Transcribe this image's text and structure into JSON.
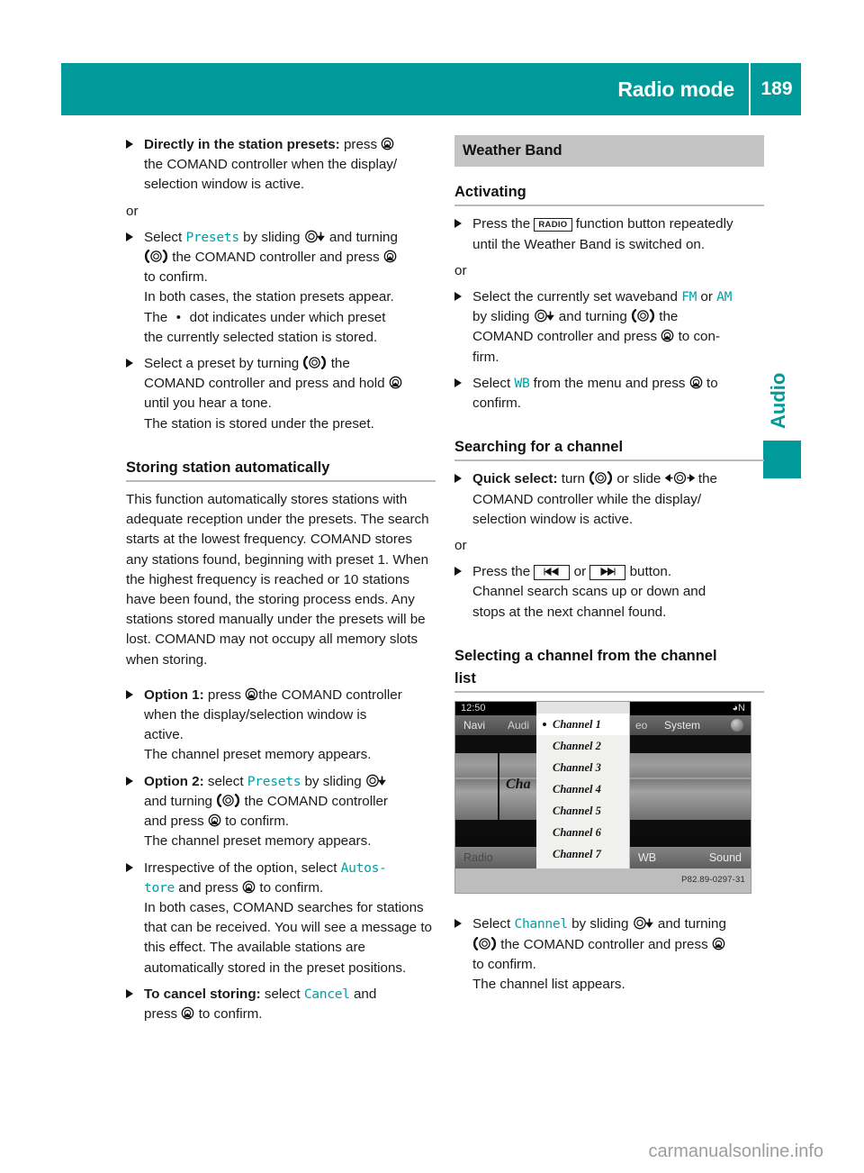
{
  "header": {
    "title": "Radio mode",
    "page_number": "189",
    "accent_color": "#009a9a"
  },
  "side_tab": {
    "label": "Audio"
  },
  "left_column": {
    "blocks": [
      {
        "lead_bold": "Directly in the station presets:",
        "lead_rest": " press",
        "line2": "the COMAND controller when the display/",
        "line3": "selection window is active."
      },
      {
        "or": "or"
      },
      {
        "sel_prefix": "Select",
        "sel_term": "Presets",
        "sel_mid": "by sliding",
        "sel_mid2": "and turning",
        "line2a": "the COMAND controller and press",
        "line3": "to confirm.",
        "line4": "In both cases, the station presets appear.",
        "line5a": "The",
        "line5b": "dot indicates under which preset",
        "line6": "the currently selected station is stored."
      },
      {
        "p1": "Select a preset by turning",
        "p2": "the",
        "line2": "COMAND controller and press and hold",
        "line3": "until you hear a tone.",
        "line4": "The station is stored under the preset."
      }
    ],
    "heading": "Storing station automatically",
    "body_paragraph": "This function automatically stores stations with adequate reception under the presets. The search starts at the lowest frequency. COMAND stores any stations found, beginning with preset 1. When the highest frequency is reached or 10 stations have been found, the storing process ends. Any stations stored manually under the presets will be lost. COMAND may not occupy all memory slots when storing.",
    "option1": {
      "bold": "Option 1:",
      "rest": " press",
      "after": "the COMAND controller",
      "line2": "when the display/selection window is",
      "line3": "active.",
      "line4": "The channel preset memory appears."
    },
    "option2": {
      "bold": "Option 2:",
      "rest": " select",
      "term": "Presets",
      "after": "by sliding",
      "line2a": "and turning",
      "line2b": "the COMAND controller",
      "line3a": "and press",
      "line3b": "to confirm.",
      "line4": "The channel preset memory appears."
    },
    "irrespective": {
      "prefix": "Irrespective of the option, select",
      "term": "Autos-",
      "term2": "tore",
      "after": "and press",
      "after2": "to confirm.",
      "body": "In both cases, COMAND searches for stations that can be received. You will see a message to this effect. The available stations are automatically stored in the preset positions."
    },
    "cancel": {
      "bold": "To cancel storing:",
      "rest": " select",
      "term": "Cancel",
      "after": "and",
      "line2a": "press",
      "line2b": "to confirm."
    }
  },
  "right_column": {
    "section_heading": "Weather Band",
    "activating": {
      "heading": "Activating",
      "step1_pre": "Press the",
      "step1_key": "RADIO",
      "step1_post": "function button repeatedly",
      "step1_line2": "until the Weather Band is switched on.",
      "or": "or",
      "step2_pre": "Select the currently set waveband",
      "step2_fm": "FM",
      "step2_or": "or",
      "step2_am": "AM",
      "step2_line2a": "by sliding",
      "step2_line2b": "and turning",
      "step2_line2c": "the",
      "step2_line3a": "COMAND controller and press",
      "step2_line3b": "to con-",
      "step2_line4": "firm.",
      "step3_pre": "Select",
      "step3_term": "WB",
      "step3_post": "from the menu and press",
      "step3_post2": "to",
      "step3_line2": "confirm."
    },
    "searching": {
      "heading": "Searching for a channel",
      "quick_bold": "Quick select:",
      "quick_rest": " turn",
      "quick_mid": "or slide",
      "quick_end": "the",
      "line2": "COMAND controller while the display/",
      "line3": "selection window is active.",
      "or": "or",
      "press_pre": "Press the",
      "key_prev": "prev-track-icon",
      "press_mid": "or",
      "key_next": "next-track-icon",
      "press_post": "button.",
      "press_line2": "Channel search scans up or down and",
      "press_line3": "stops at the next channel found."
    },
    "selecting": {
      "heading_line1": "Selecting a channel from the channel",
      "heading_line2": "list",
      "step_pre": "Select",
      "step_term": "Channel",
      "step_mid": "by sliding",
      "step_mid2": "and turning",
      "line2a": "the COMAND controller and press",
      "line3": "to confirm.",
      "line4": "The channel list appears."
    },
    "figure": {
      "status_time": "12:50",
      "status_right": "N",
      "menu_navi": "Navi",
      "menu_audio": "Audi",
      "menu_video": "eo",
      "menu_system": "System",
      "center_label": "Cha",
      "bottom_radio": "Radio",
      "bottom_wb": "WB",
      "bottom_sound": "Sound",
      "list_items": [
        "Channel 1",
        "Channel 2",
        "Channel 3",
        "Channel 4",
        "Channel 5",
        "Channel 6",
        "Channel 7"
      ],
      "selected_index": 0,
      "caption": "P82.89-0297-31"
    }
  },
  "watermark": "carmanualsonline.info"
}
